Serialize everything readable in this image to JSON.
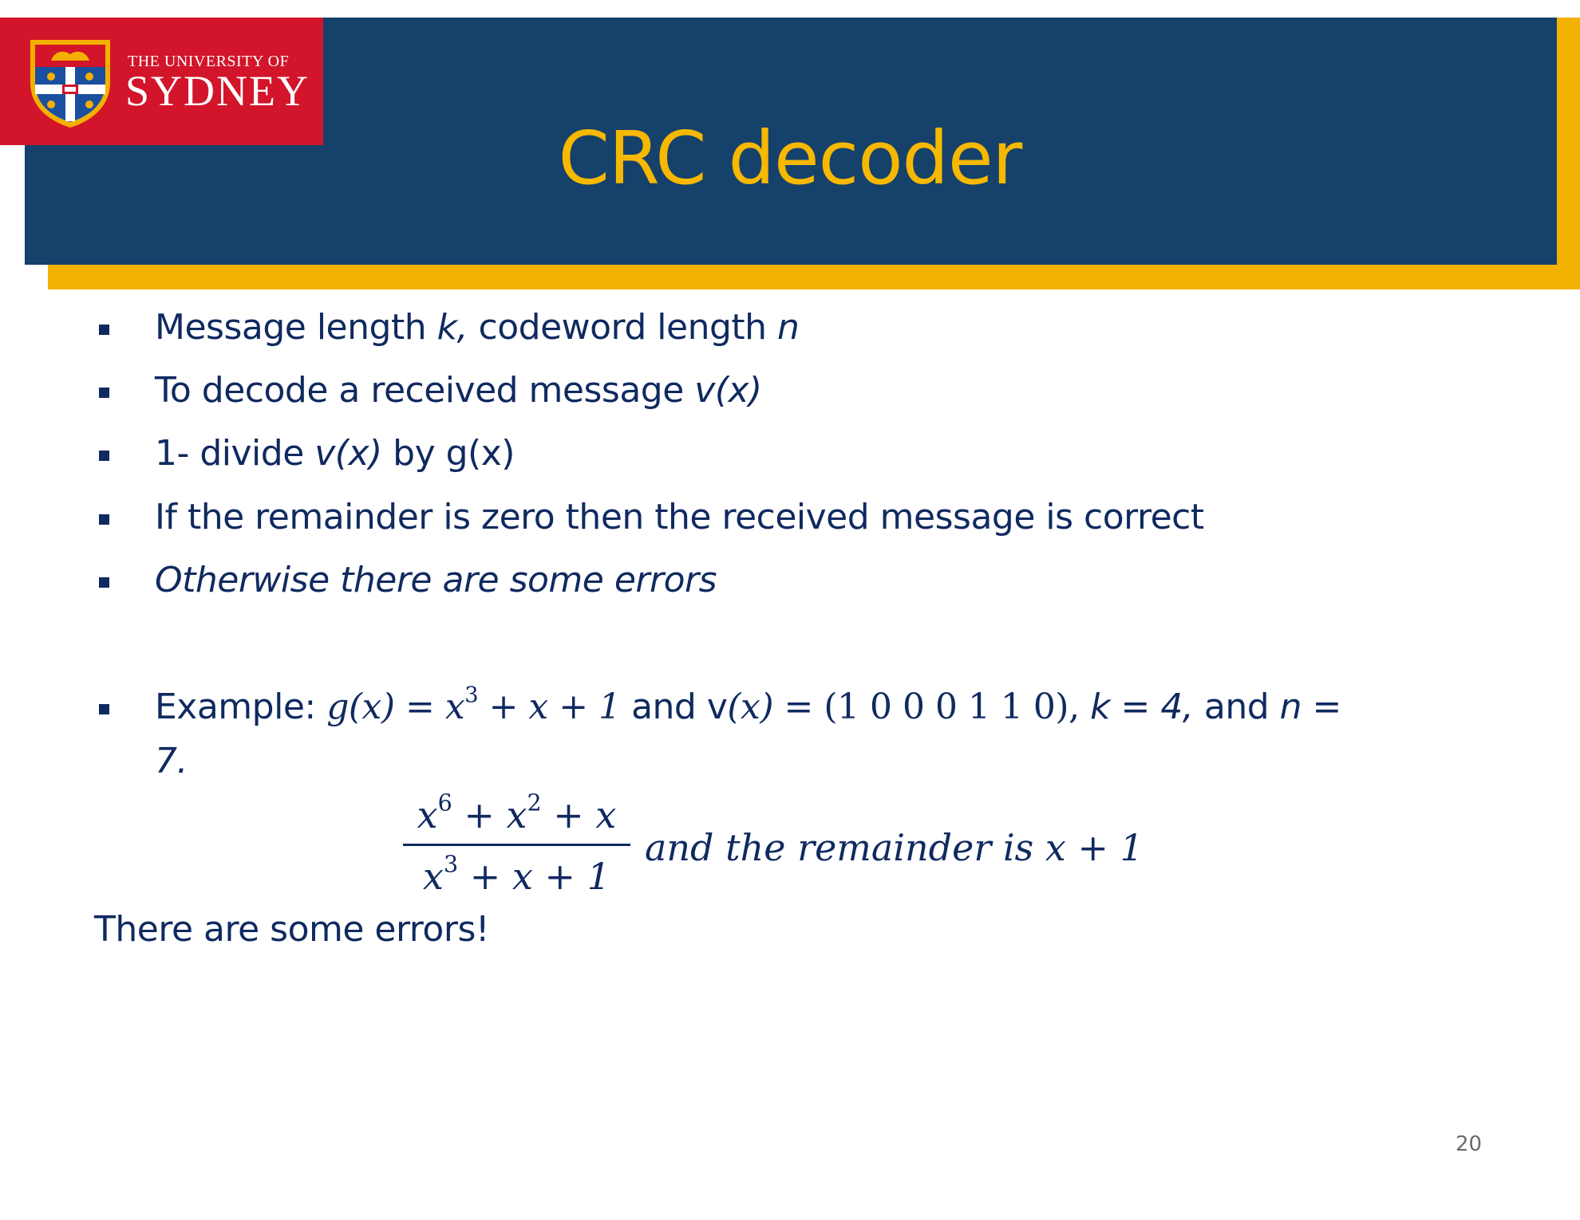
{
  "header": {
    "title": "CRC decoder",
    "logo": {
      "line1": "THE UNIVERSITY OF",
      "line2": "SYDNEY"
    }
  },
  "bullets": [
    {
      "parts": [
        "Message length ",
        "k,",
        "  codeword length ",
        "n"
      ]
    },
    {
      "parts": [
        "To decode a received message ",
        "v(x)"
      ]
    },
    {
      "parts": [
        "1- divide ",
        "v(x)",
        " by g(x)"
      ]
    },
    {
      "parts": [
        "If the remainder is zero then the received message is correct"
      ]
    },
    {
      "parts": [
        "Otherwise there are some errors"
      ]
    }
  ],
  "example": {
    "label": "Example:",
    "gx_lhs": "g(x) =",
    "gx_rhs_x": "x",
    "gx_rhs_exp": "3",
    "gx_rhs_rest": " + x + 1",
    "and1": " and v",
    "vx_arg": "(x)",
    "vx_rhs": " = (1 0 0 0 1 1 0),",
    "k": " k = 4,",
    "and2": "  and ",
    "n": "n =",
    "n_wrap": "7."
  },
  "fraction": {
    "num_parts": [
      "x",
      "6",
      " + x",
      "2",
      " + x"
    ],
    "den_parts": [
      "x",
      "3",
      " + x + 1"
    ],
    "tail": "and the remainder is x + 1"
  },
  "conclusion": "There are some errors!",
  "page_number": "20",
  "colors": {
    "header_bg": "#15416b",
    "title": "#f6b800",
    "accent_gold": "#f4b000",
    "logo_red": "#d2152a",
    "text": "#102a60"
  }
}
